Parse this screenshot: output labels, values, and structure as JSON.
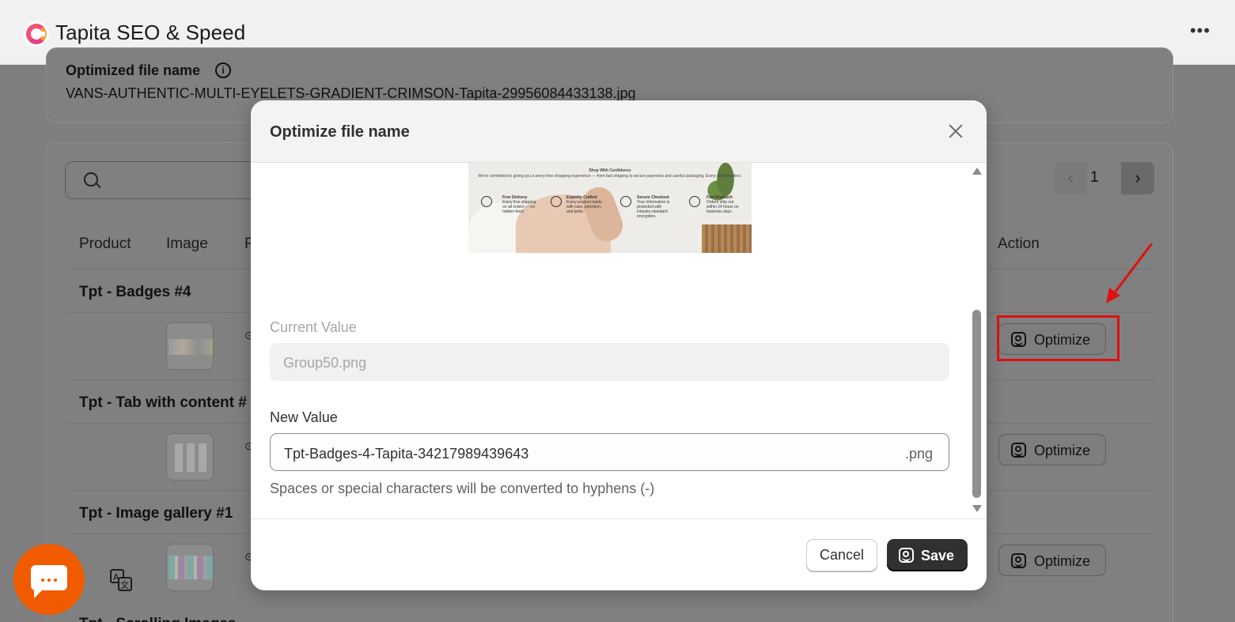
{
  "app": {
    "title": "Tapita SEO & Speed",
    "more": "•••"
  },
  "background": {
    "optimized_label": "Optimized file name",
    "optimized_value": "VANS-AUTHENTIC-MULTI-EYELETS-GRADIENT-CRIMSON-Tapita-29956084433138.jpg",
    "pagination": {
      "prev": "‹",
      "page": "1",
      "next": "›"
    },
    "columns": [
      "Product",
      "Image",
      "F",
      "Action"
    ],
    "rows": [
      {
        "product": "Tpt - Badges #4",
        "action": "Optimize"
      },
      {
        "product": "Tpt - Tab with content #",
        "action": "Optimize"
      },
      {
        "product": "Tpt - Image gallery #1",
        "action": "Optimize"
      },
      {
        "product": "Tpt - Scrolling Images"
      }
    ]
  },
  "modal": {
    "title": "Optimize file name",
    "preview_caption": "Shop With Confidence",
    "preview_subcaption": "We're committed to giving you a worry-free shopping experience — from fast shipping to secure payments and careful packaging. Every detail matters.",
    "preview_features": [
      {
        "title": "Free Delivery",
        "text": "Enjoy free shipping on all orders — no hidden fees!"
      },
      {
        "title": "Expertly Crafted",
        "text": "Every product made with care, precision, and pride."
      },
      {
        "title": "Secure Checkout",
        "text": "Your information is protected with industry-standard encryption."
      },
      {
        "title": "Fast Dispatch",
        "text": "Orders ship out within 24 hours on business days."
      }
    ],
    "current_label": "Current Value",
    "current_value": "Group50.png",
    "new_label": "New Value",
    "new_value": "Tpt-Badges-4-Tapita-34217989439643",
    "new_suffix": ".png",
    "help": "Spaces or special characters will be converted to hyphens (-)",
    "cancel": "Cancel",
    "save": "Save"
  },
  "colors": {
    "accent_red": "#e01010",
    "chat_orange": "#f05b00",
    "primary_dark": "#303030"
  }
}
